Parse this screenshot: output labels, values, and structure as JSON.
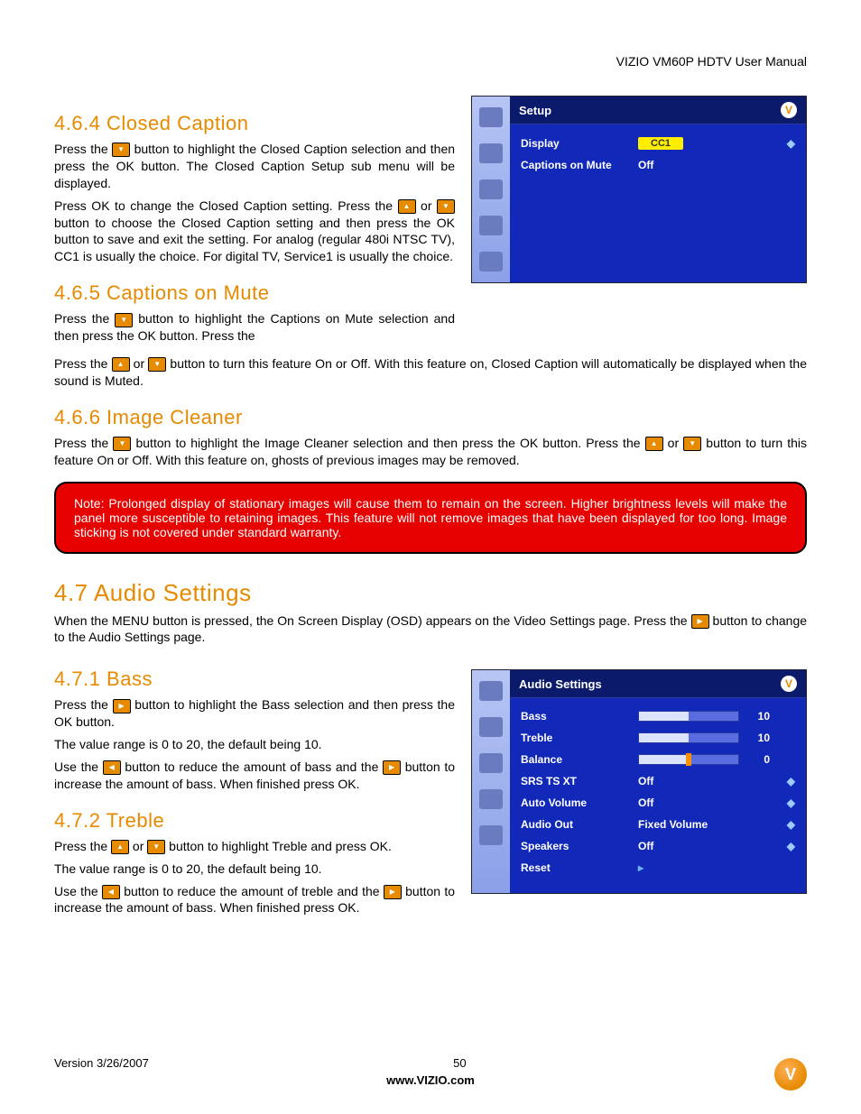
{
  "header": {
    "title": "VIZIO VM60P HDTV User Manual"
  },
  "s464": {
    "heading": "4.6.4 Closed Caption",
    "p1a": "Press the ",
    "p1b": " button to highlight the Closed Caption selection and then press the OK button. The Closed Caption Setup sub menu will be displayed.",
    "p2a": "Press OK to change the Closed Caption setting. Press the ",
    "p2b": " or ",
    "p2c": " button to choose the Closed Caption setting and then press the OK button to save and exit the setting.  For analog (regular 480i NTSC TV), CC1 is usually the choice.  For digital TV, Service1 is usually the choice."
  },
  "s465": {
    "heading": "4.6.5 Captions on Mute",
    "p1a": "Press the ",
    "p1b": " button to highlight the Captions on Mute selection and then press the OK button. Press the ",
    "p1c": " or ",
    "p1d": " button to turn this feature On or Off.  With this feature on, Closed Caption will automatically be displayed when the sound is Muted."
  },
  "s466": {
    "heading": "4.6.6 Image Cleaner",
    "p1a": "Press the ",
    "p1b": " button to highlight the Image Cleaner selection and then press the OK button.  Press the ",
    "p1c": " or ",
    "p1d": " button to turn this feature On or Off.  With this feature on, ghosts of previous images may be removed."
  },
  "note": "Note:  Prolonged display of stationary images will cause them to remain on the screen.  Higher brightness levels will make the panel more susceptible to retaining images.  This feature will not remove images that have been displayed for too long.  Image sticking is not covered under standard warranty.",
  "s47": {
    "heading": "4.7 Audio Settings",
    "p1a": "When the MENU button is pressed, the On Screen Display (OSD) appears on the Video Settings page. Press the ",
    "p1b": " button to change to the Audio Settings page."
  },
  "s471": {
    "heading": "4.7.1 Bass",
    "p1a": "Press the ",
    "p1b": " button to highlight the Bass selection and then press the OK button.",
    "p2": "The value range is 0 to 20, the default being 10.",
    "p3a": "Use the ",
    "p3b": " button to reduce the amount of bass and the ",
    "p3c": " button to increase the amount of bass.  When finished press OK."
  },
  "s472": {
    "heading": "4.7.2 Treble",
    "p1a": "Press the ",
    "p1b": " or ",
    "p1c": " button to highlight Treble and press OK.",
    "p2": "The value range is 0 to 20, the default being 10.",
    "p3a": "Use the ",
    "p3b": " button to reduce the amount of treble and the ",
    "p3c": " button to increase the amount of bass.  When finished press OK."
  },
  "osd1": {
    "title": "Setup",
    "rows": [
      {
        "label": "Display",
        "value": "CC1",
        "highlight": true
      },
      {
        "label": "Captions on Mute",
        "value": "Off"
      }
    ]
  },
  "osd2": {
    "title": "Audio Settings",
    "rows": [
      {
        "label": "Bass",
        "type": "slider",
        "value": "10",
        "fill": 50
      },
      {
        "label": "Treble",
        "type": "slider",
        "value": "10",
        "fill": 50
      },
      {
        "label": "Balance",
        "type": "slider",
        "value": "0",
        "fill": 50,
        "knob": 50
      },
      {
        "label": "SRS TS XT",
        "type": "text",
        "value": "Off"
      },
      {
        "label": "Auto Volume",
        "type": "text",
        "value": "Off"
      },
      {
        "label": "Audio Out",
        "type": "text",
        "value": "Fixed Volume"
      },
      {
        "label": "Speakers",
        "type": "text",
        "value": "Off"
      },
      {
        "label": "Reset",
        "type": "arrow",
        "value": "▸"
      }
    ]
  },
  "footer": {
    "version": "Version 3/26/2007",
    "page": "50",
    "url": "www.VIZIO.com",
    "logo": "V"
  }
}
